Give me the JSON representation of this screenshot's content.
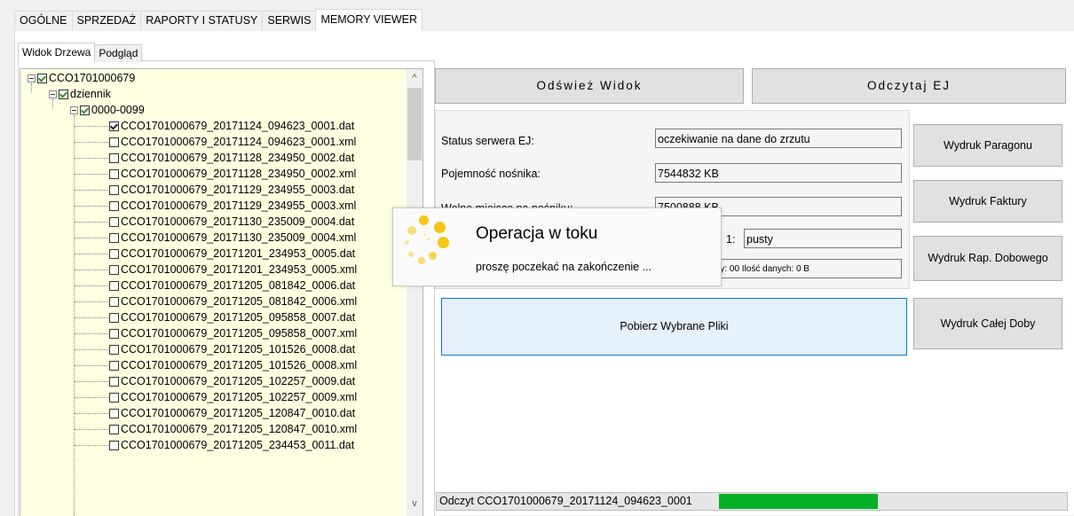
{
  "main_tabs": [
    {
      "label": "OGÓLNE",
      "active": false
    },
    {
      "label": "SPRZEDAŻ",
      "active": false
    },
    {
      "label": "RAPORTY I STATUSY",
      "active": false
    },
    {
      "label": "SERWIS",
      "active": false
    },
    {
      "label": "MEMORY VIEWER",
      "active": true
    }
  ],
  "sub_tabs": [
    {
      "label": "Widok Drzewa",
      "active": true
    },
    {
      "label": "Podgląd",
      "active": false
    }
  ],
  "tree": {
    "root": "CCO1701000679",
    "folder": "dziennik",
    "subfolder": "0000-0099",
    "files": [
      {
        "name": "CCO1701000679_20171124_094623_0001.dat",
        "checked": true
      },
      {
        "name": "CCO1701000679_20171124_094623_0001.xml",
        "checked": false
      },
      {
        "name": "CCO1701000679_20171128_234950_0002.dat",
        "checked": false
      },
      {
        "name": "CCO1701000679_20171128_234950_0002.xml",
        "checked": false
      },
      {
        "name": "CCO1701000679_20171129_234955_0003.dat",
        "checked": false
      },
      {
        "name": "CCO1701000679_20171129_234955_0003.xml",
        "checked": false
      },
      {
        "name": "CCO1701000679_20171130_235009_0004.dat",
        "checked": false
      },
      {
        "name": "CCO1701000679_20171130_235009_0004.xml",
        "checked": false
      },
      {
        "name": "CCO1701000679_20171201_234953_0005.dat",
        "checked": false
      },
      {
        "name": "CCO1701000679_20171201_234953_0005.xml",
        "checked": false
      },
      {
        "name": "CCO1701000679_20171205_081842_0006.dat",
        "checked": false
      },
      {
        "name": "CCO1701000679_20171205_081842_0006.xml",
        "checked": false
      },
      {
        "name": "CCO1701000679_20171205_095858_0007.dat",
        "checked": false
      },
      {
        "name": "CCO1701000679_20171205_095858_0007.xml",
        "checked": false
      },
      {
        "name": "CCO1701000679_20171205_101526_0008.dat",
        "checked": false
      },
      {
        "name": "CCO1701000679_20171205_101526_0008.xml",
        "checked": false
      },
      {
        "name": "CCO1701000679_20171205_102257_0009.dat",
        "checked": false
      },
      {
        "name": "CCO1701000679_20171205_102257_0009.xml",
        "checked": false
      },
      {
        "name": "CCO1701000679_20171205_120847_0010.dat",
        "checked": false
      },
      {
        "name": "CCO1701000679_20171205_120847_0010.xml",
        "checked": false
      },
      {
        "name": "CCO1701000679_20171205_234453_0011.dat",
        "checked": false
      }
    ]
  },
  "buttons": {
    "refresh": "Odśwież Widok",
    "read_ej": "Odczytaj EJ",
    "print_receipt": "Wydruk Paragonu",
    "print_invoice": "Wydruk Faktury",
    "print_daily": "Wydruk Rap. Dobowego",
    "print_whole_day": "Wydruk Całej Doby",
    "download": "Pobierz Wybrane Pliki"
  },
  "status": {
    "server_label": "Status serwera EJ:",
    "server_value": "oczekiwanie na dane do zrzutu",
    "capacity_label": "Pojemność nośnika:",
    "capacity_value": "7544832 KB",
    "free_label": "Wolne miejsce na nośniku:",
    "free_value": "7500888 KB",
    "slot_label": "1:",
    "slot_value": "pusty",
    "day_value": "Doby: 00 Ilość danych: 0 B"
  },
  "popup": {
    "title": "Operacja w toku",
    "message": "proszę poczekać na zakończenie ..."
  },
  "progress": {
    "text": "Odczyt CCO1701000679_20171124_094623_0001",
    "fill_color": "#06b025"
  },
  "scroll": {
    "up": "^",
    "down": "v"
  }
}
